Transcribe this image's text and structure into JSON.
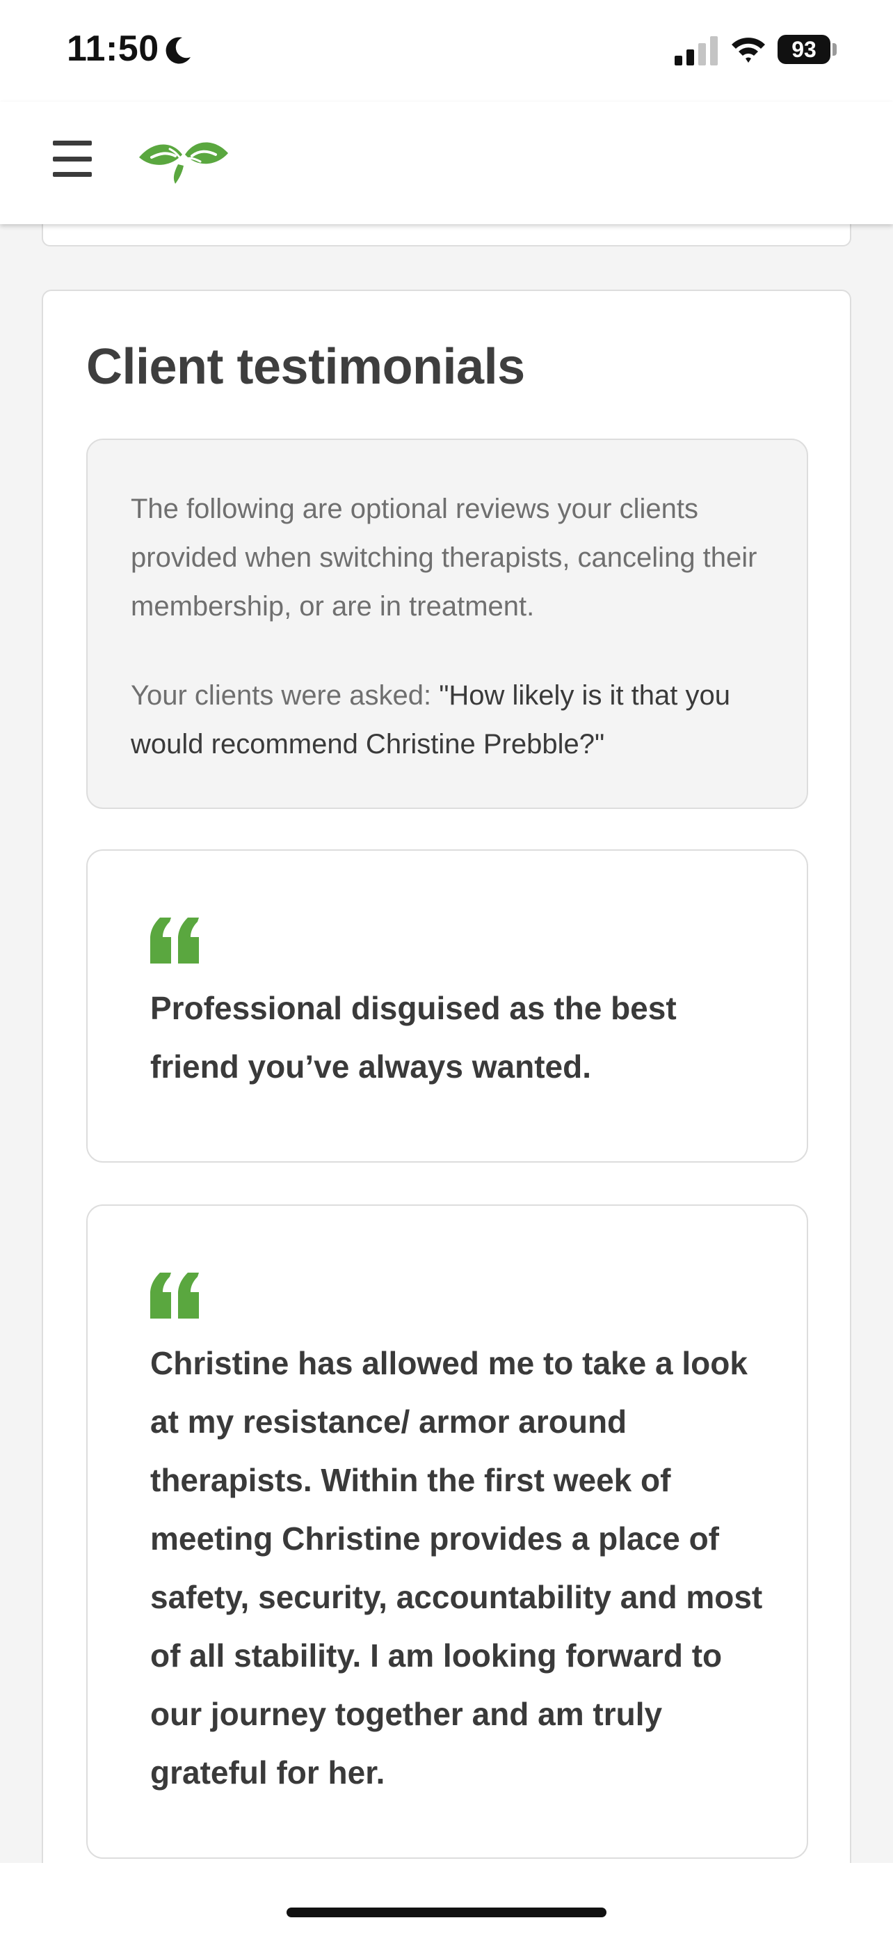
{
  "status_bar": {
    "time": "11:50",
    "battery": "93",
    "icons": [
      "moon-icon",
      "cellular-signal-icon",
      "wifi-icon",
      "battery-icon"
    ]
  },
  "header": {
    "menu_icon": "hamburger-menu-icon",
    "logo_icon": "leaf-hands-logo",
    "brand_color": "#5aa73f"
  },
  "testimonials_section": {
    "title": "Client testimonials",
    "intro": "The following are optional reviews your clients provided when switching therapists, canceling their membership, or are in treatment.",
    "question_prefix": "Your clients were asked: ",
    "question": "\"How likely is it that you would recommend Christine Prebble?\"",
    "quote_icon": "quote-mark-icon",
    "items": [
      {
        "text": "Professional disguised as the best friend you’ve always wanted."
      },
      {
        "text": "Christine has allowed me to take a look at my resistance/ armor around therapists. Within the first week of meeting Christine provides a place of safety, security, accountability and most of all stability. I am looking forward to our journey together and am truly grateful for her."
      }
    ]
  },
  "colors": {
    "page_background": "#f4f4f4",
    "card_background": "#ffffff",
    "card_border": "#dddddd",
    "text_dark": "#3e3e3e",
    "text_muted": "#6f6f6f",
    "accent_green": "#5aa73f"
  }
}
